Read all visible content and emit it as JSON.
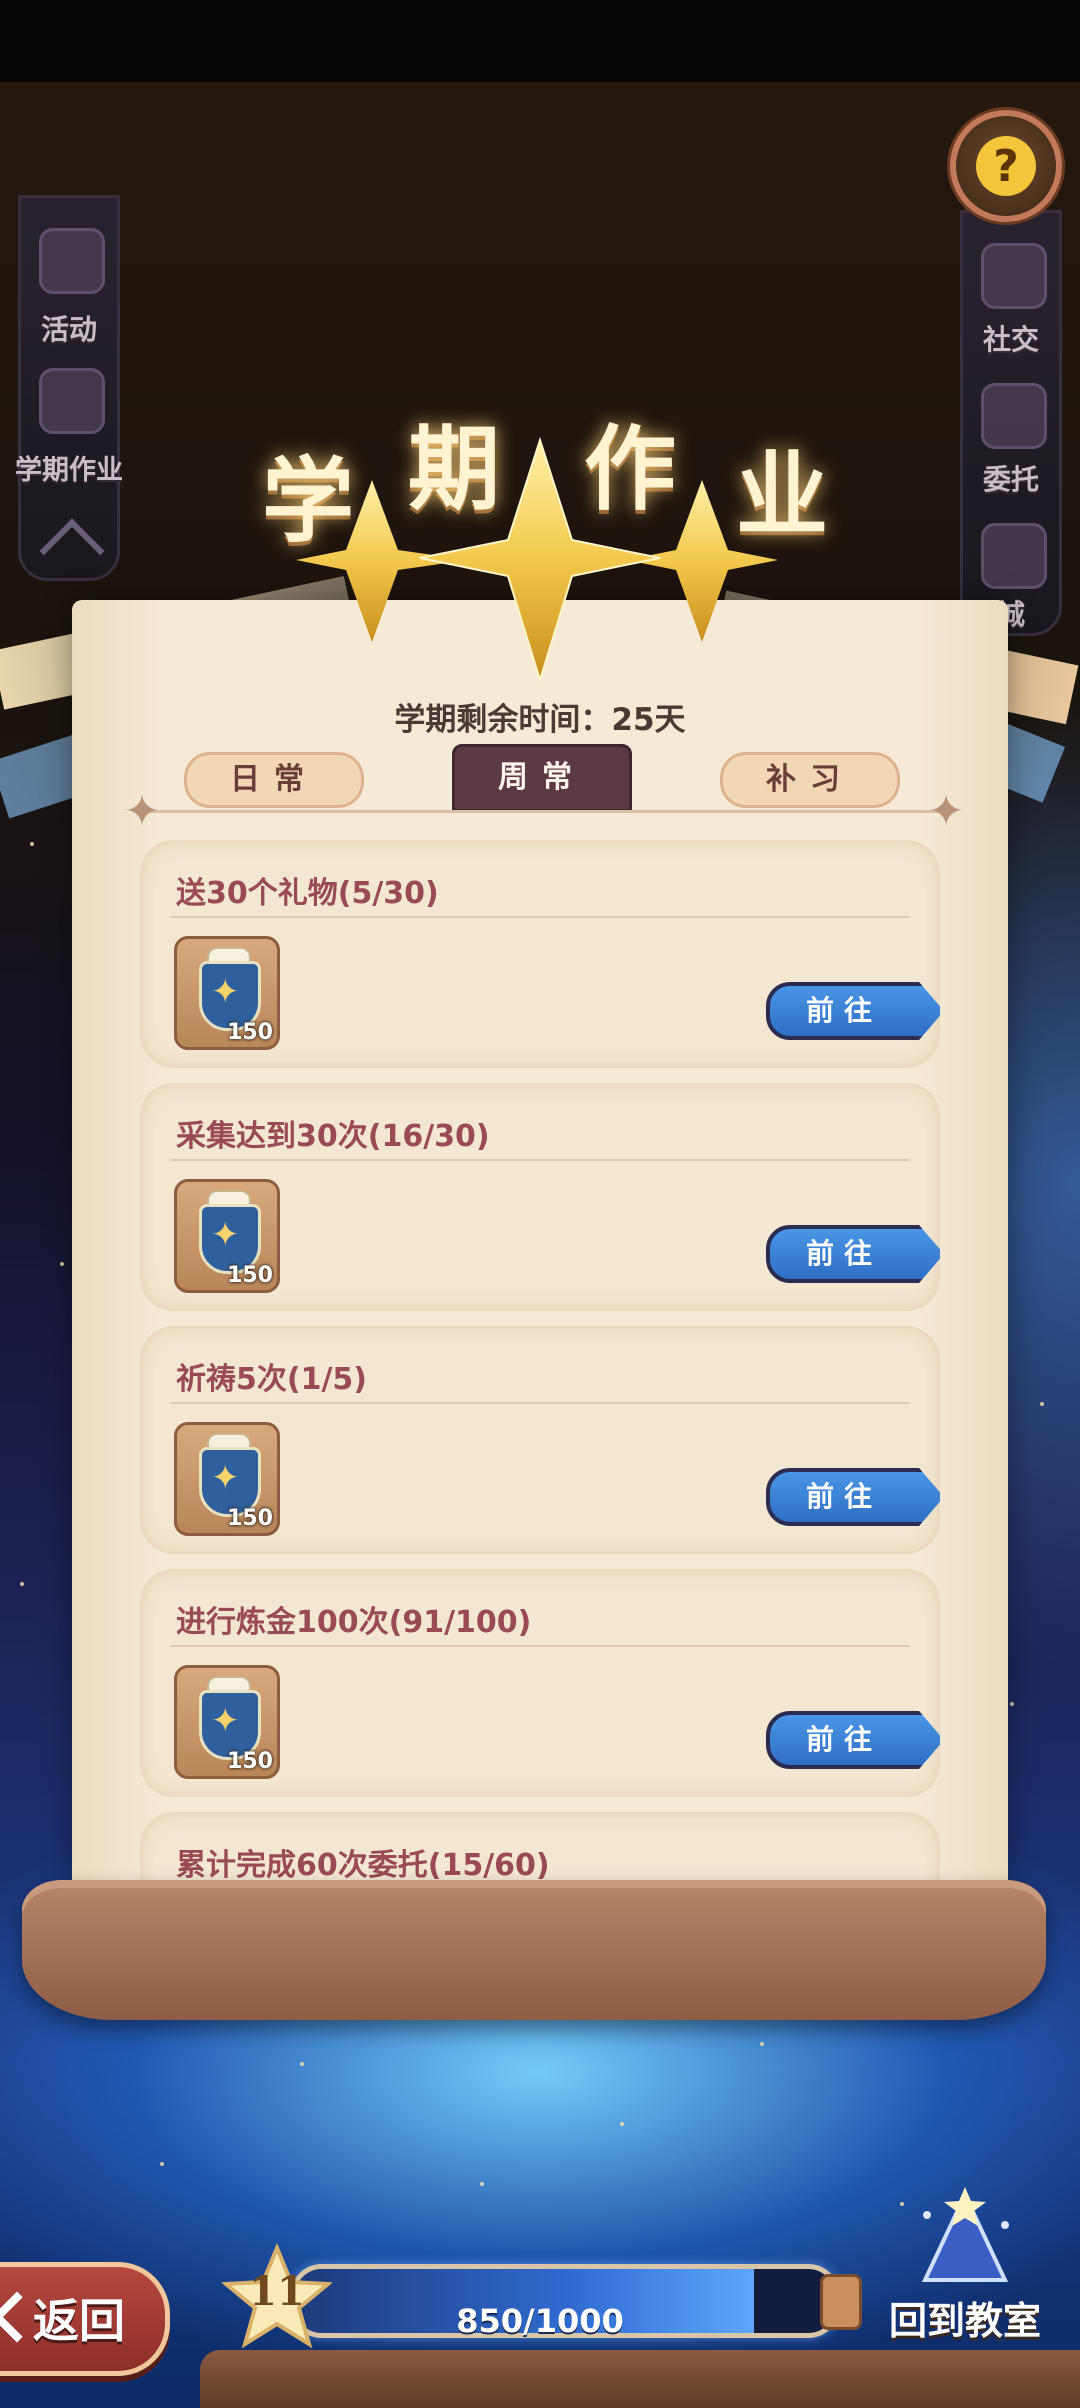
{
  "title": {
    "chars": [
      "学",
      "期",
      "作",
      "业"
    ]
  },
  "remaining_time": "学期剩余时间：25天",
  "tabs": [
    {
      "label": "日常",
      "active": false
    },
    {
      "label": "周常",
      "active": true
    },
    {
      "label": "补习",
      "active": false
    }
  ],
  "side_left": {
    "items": [
      {
        "label": "活动"
      },
      {
        "label": "学期作业"
      }
    ]
  },
  "side_right": {
    "items": [
      {
        "label": "社交"
      },
      {
        "label": "委托"
      },
      {
        "label": "城"
      }
    ]
  },
  "help": {
    "glyph": "?"
  },
  "tasks": [
    {
      "title": "送30个礼物(5/30)",
      "reward_qty": "150",
      "button": "前往"
    },
    {
      "title": "采集达到30次(16/30)",
      "reward_qty": "150",
      "button": "前往"
    },
    {
      "title": "祈祷5次(1/5)",
      "reward_qty": "150",
      "button": "前往"
    },
    {
      "title": "进行炼金100次(91/100)",
      "reward_qty": "150",
      "button": "前往"
    },
    {
      "title": "累计完成60次委托(15/60)",
      "reward_qty": "",
      "button": ""
    }
  ],
  "footer": {
    "back_label": "返回",
    "level": "11",
    "exp_text": "850/1000",
    "exp_fraction": 0.85,
    "classroom_label": "回到教室"
  },
  "colors": {
    "accent_blue": "#2e6fc4",
    "tab_active": "#5b3a45",
    "task_title": "#9a4a55"
  }
}
